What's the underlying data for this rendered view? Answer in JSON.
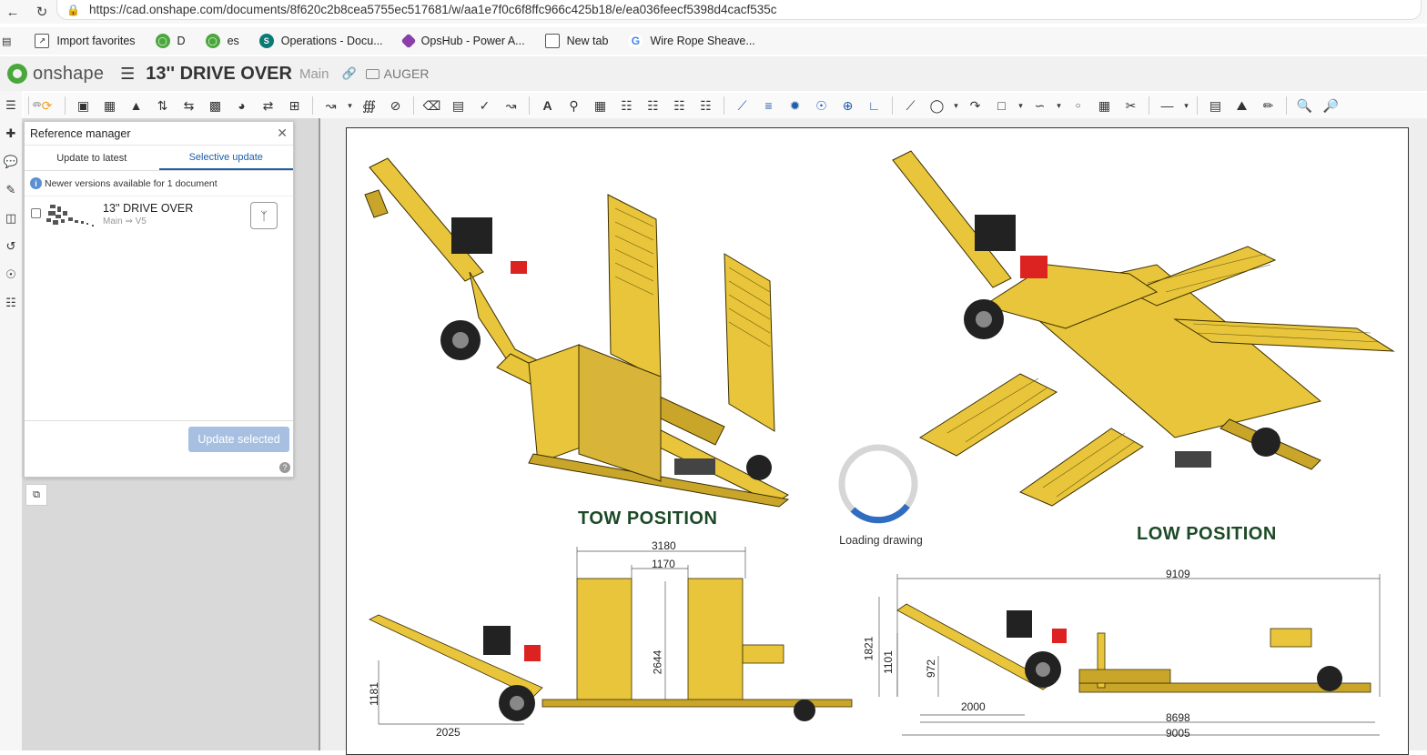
{
  "browser": {
    "url": "https://cad.onshape.com/documents/8f620c2b8cea5755ec517681/w/aa1e7f0c6f8ffc966c425b18/e/ea036feecf5398d4cacf535c",
    "bookmarks": [
      {
        "label": "Import favorites",
        "icon": "import-icon",
        "color": "#666666"
      },
      {
        "label": "D",
        "icon": "onshape-icon",
        "color": "#4aa73c"
      },
      {
        "label": "es",
        "icon": "onshape-icon",
        "color": "#4aa73c"
      },
      {
        "label": "Operations - Docu...",
        "icon": "sharepoint-icon",
        "color": "#0b7a75"
      },
      {
        "label": "OpsHub - Power A...",
        "icon": "powerapps-icon",
        "color": "#8a3ea8"
      },
      {
        "label": "New tab",
        "icon": "newtab-icon",
        "color": "#555555"
      },
      {
        "label": "Wire Rope Sheave...",
        "icon": "google-icon",
        "color": "#4285f4"
      }
    ]
  },
  "app": {
    "logo_text": "onshape",
    "doc_title": "13'' DRIVE OVER",
    "branch": "Main",
    "folder": "AUGER"
  },
  "ref_manager": {
    "title": "Reference manager",
    "tabs": [
      "Update to latest",
      "Selective update"
    ],
    "active_tab": 1,
    "notice": "Newer versions available for 1 document",
    "doc_name": "13'' DRIVE OVER",
    "doc_version": "Main ⇒ V5",
    "update_button": "Update selected"
  },
  "drawing": {
    "caption_left": "TOW POSITION",
    "caption_right": "LOW POSITION",
    "loading_text": "Loading drawing",
    "dims_left": [
      "3180",
      "1170",
      "2644",
      "1181",
      "2025"
    ],
    "dims_right": [
      "9109",
      "1821",
      "1101",
      "972",
      "2000",
      "8698",
      "9005"
    ]
  }
}
